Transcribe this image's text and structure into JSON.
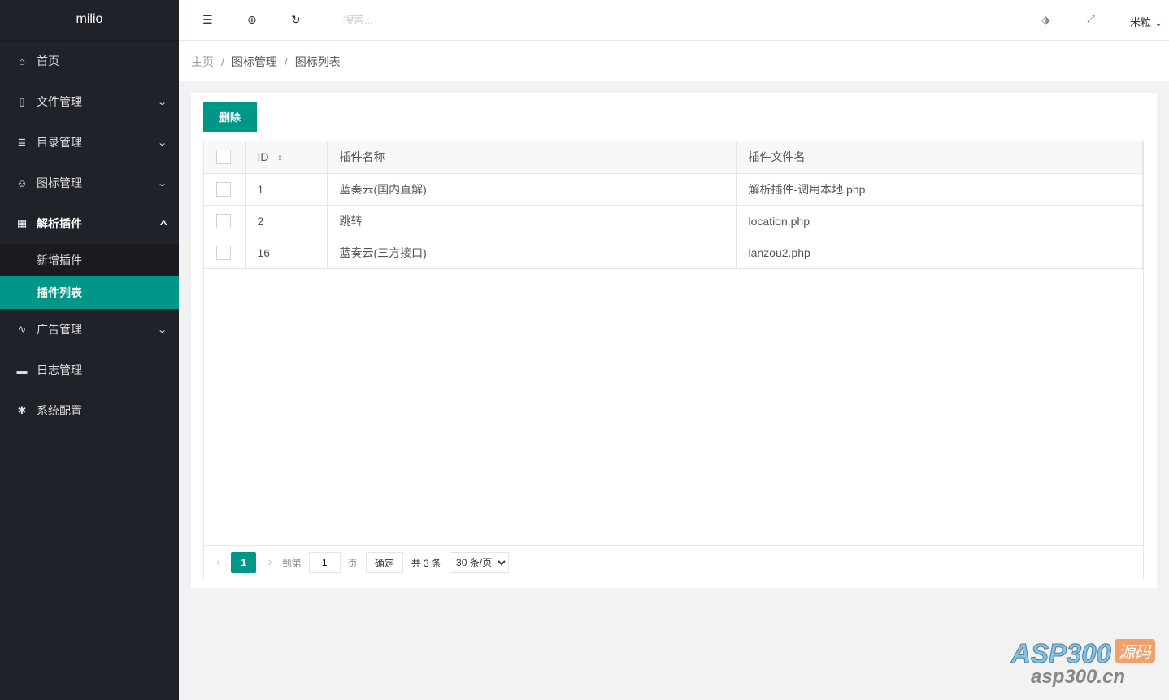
{
  "app": {
    "title": "milio"
  },
  "sidebar": {
    "items": [
      {
        "label": "首页",
        "icon": "home-icon"
      },
      {
        "label": "文件管理",
        "icon": "file-icon"
      },
      {
        "label": "目录管理",
        "icon": "list-icon"
      },
      {
        "label": "图标管理",
        "icon": "smile-icon"
      },
      {
        "label": "解析插件",
        "icon": "apps-icon",
        "children": [
          {
            "label": "新增插件"
          },
          {
            "label": "插件列表"
          }
        ]
      },
      {
        "label": "广告管理",
        "icon": "pulse-icon"
      },
      {
        "label": "日志管理",
        "icon": "monitor-icon"
      },
      {
        "label": "系统配置",
        "icon": "gear-icon"
      }
    ]
  },
  "header": {
    "search_placeholder": "搜索...",
    "user": "米粒"
  },
  "breadcrumb": [
    "主页",
    "图标管理",
    "图标列表"
  ],
  "toolbar": {
    "delete_label": "删除"
  },
  "table": {
    "columns": [
      "ID",
      "插件名称",
      "插件文件名"
    ],
    "rows": [
      {
        "id": "1",
        "name": "蓝奏云(国内直解)",
        "file": "解析插件-调用本地.php"
      },
      {
        "id": "2",
        "name": "跳转",
        "file": "location.php"
      },
      {
        "id": "16",
        "name": "蓝奏云(三方接口)",
        "file": "lanzou2.php"
      }
    ]
  },
  "pager": {
    "current": "1",
    "goto_label": "到第",
    "goto_value": "1",
    "page_label": "页",
    "confirm": "确定",
    "total": "共 3 条",
    "page_size": "30 条/页"
  },
  "watermark": {
    "brand": "ASP300",
    "tag": "源码",
    "url": "asp300.cn"
  }
}
